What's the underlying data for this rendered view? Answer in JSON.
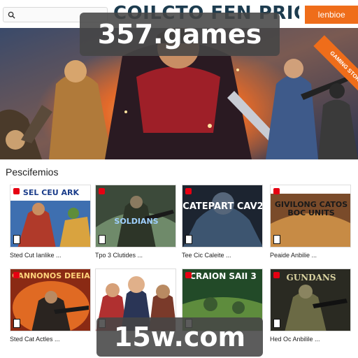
{
  "header": {
    "site_title": "COILCTO FEN PRIOS",
    "button_label": "Ienbioe"
  },
  "hero": {
    "ribbon_text": "GAMING STORE"
  },
  "overlays": {
    "top": "357.games",
    "bottom": "15w.com"
  },
  "section": {
    "title": "Pescifemios"
  },
  "cards": [
    {
      "cover": "SEL CEU ARK",
      "caption": "Sted Cut Ianlike ...",
      "colors": [
        "#3e6fb0",
        "#d9a33f"
      ]
    },
    {
      "cover": "SOLDIANS",
      "caption": "Tpo 3 Clutides ...",
      "colors": [
        "#3c4a3a",
        "#6f8a6a"
      ]
    },
    {
      "cover": "CATEPART CAV2",
      "caption": "Tee Cic Caleite ...",
      "colors": [
        "#1c2430",
        "#3d5570"
      ]
    },
    {
      "cover": "GIVILONG CATOS BOC UNITS",
      "caption": "Peaide Anbilie ...",
      "colors": [
        "#7a4b2a",
        "#c78b45"
      ]
    },
    {
      "cover": "CANNONOS DEEIA",
      "caption": "Sted Cat Actles ...",
      "colors": [
        "#8a2a14",
        "#e06a23"
      ]
    },
    {
      "cover": "",
      "caption": "",
      "colors": [
        "#2a3556",
        "#b98a62"
      ]
    },
    {
      "cover": "CRAION SAII 3",
      "caption": "",
      "colors": [
        "#224a28",
        "#5e8c3d"
      ]
    },
    {
      "cover": "GUNDANS",
      "caption": "Hed Oc Anbilile ...",
      "colors": [
        "#2a2a22",
        "#6b6a45"
      ]
    }
  ],
  "icons": {
    "search": "search-icon",
    "platform": "nintendo-switch-badge-icon",
    "rating": "age-rating-icon"
  },
  "colors": {
    "accent": "#ef6d1a",
    "title": "#1d3c4f",
    "overlay": "#464646"
  }
}
